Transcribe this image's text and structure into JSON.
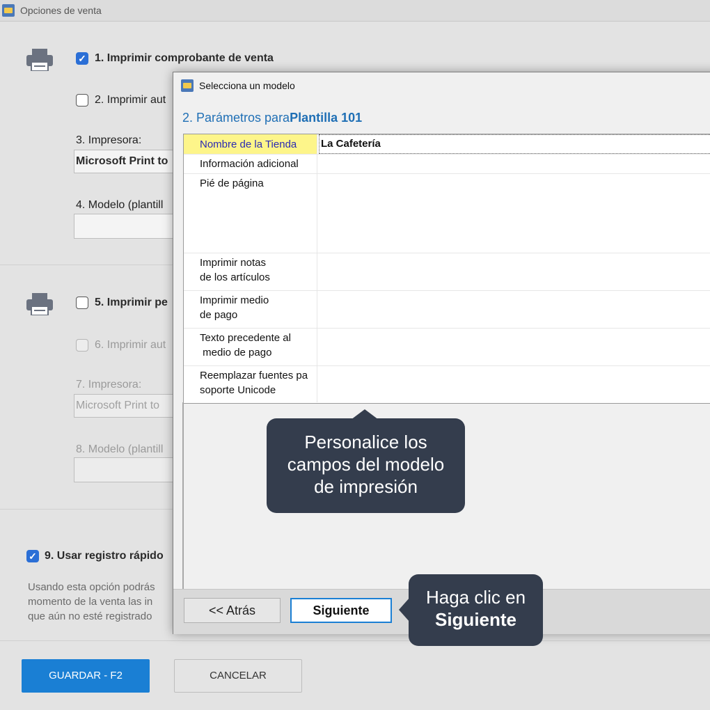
{
  "background_window": {
    "title": "Opciones de venta",
    "opt1": "1. Imprimir comprobante de venta",
    "opt2": "2. Imprimir aut",
    "opt3_label": "3. Impresora:",
    "opt3_value": "Microsoft Print to",
    "opt4_label": "4. Modelo (plantill",
    "opt5": "5. Imprimir pe",
    "opt6": "6. Imprimir aut",
    "opt7_label": "7. Impresora:",
    "opt7_value": "Microsoft Print to",
    "opt8_label": "8. Modelo (plantill",
    "opt9": "9. Usar registro rápido",
    "desc_line1": "Usando esta opción podrás",
    "desc_line2": "momento de la venta las in",
    "desc_line3": "que aún no esté registrado",
    "save_button": "GUARDAR - F2",
    "cancel_button": "CANCELAR",
    "opt1_checked": true,
    "opt9_checked": true
  },
  "dialog": {
    "title": "Selecciona un modelo",
    "heading_prefix": "2. Parámetros para",
    "heading_template": "Plantilla 101",
    "rows": [
      {
        "label_l1": "Nombre de la Tienda",
        "label_l2": "",
        "value": "La Cafetería"
      },
      {
        "label_l1": "Información adicional",
        "label_l2": "",
        "value": ""
      },
      {
        "label_l1": "Pié de página",
        "label_l2": "",
        "value": ""
      },
      {
        "label_l1": "Imprimir notas",
        "label_l2": "de los artículos",
        "value": ""
      },
      {
        "label_l1": "Imprimir medio",
        "label_l2": "de pago",
        "value": ""
      },
      {
        "label_l1": "Texto precedente al",
        "label_l2": " medio de pago",
        "value": ""
      },
      {
        "label_l1": "Reemplazar fuentes pa",
        "label_l2": "soporte Unicode",
        "value": ""
      }
    ],
    "back_button": "<< Atrás",
    "next_button": "Siguiente"
  },
  "tooltips": {
    "fields_l1": "Personalice los",
    "fields_l2": "campos del modelo",
    "fields_l3": "de impresión",
    "next_l1": "Haga clic en",
    "next_l2": "Siguiente"
  },
  "colors": {
    "accent": "#1a7fd4",
    "heading": "#1f6fb5",
    "selected_row": "#fdf58a",
    "tooltip_bg": "#343d4d"
  }
}
